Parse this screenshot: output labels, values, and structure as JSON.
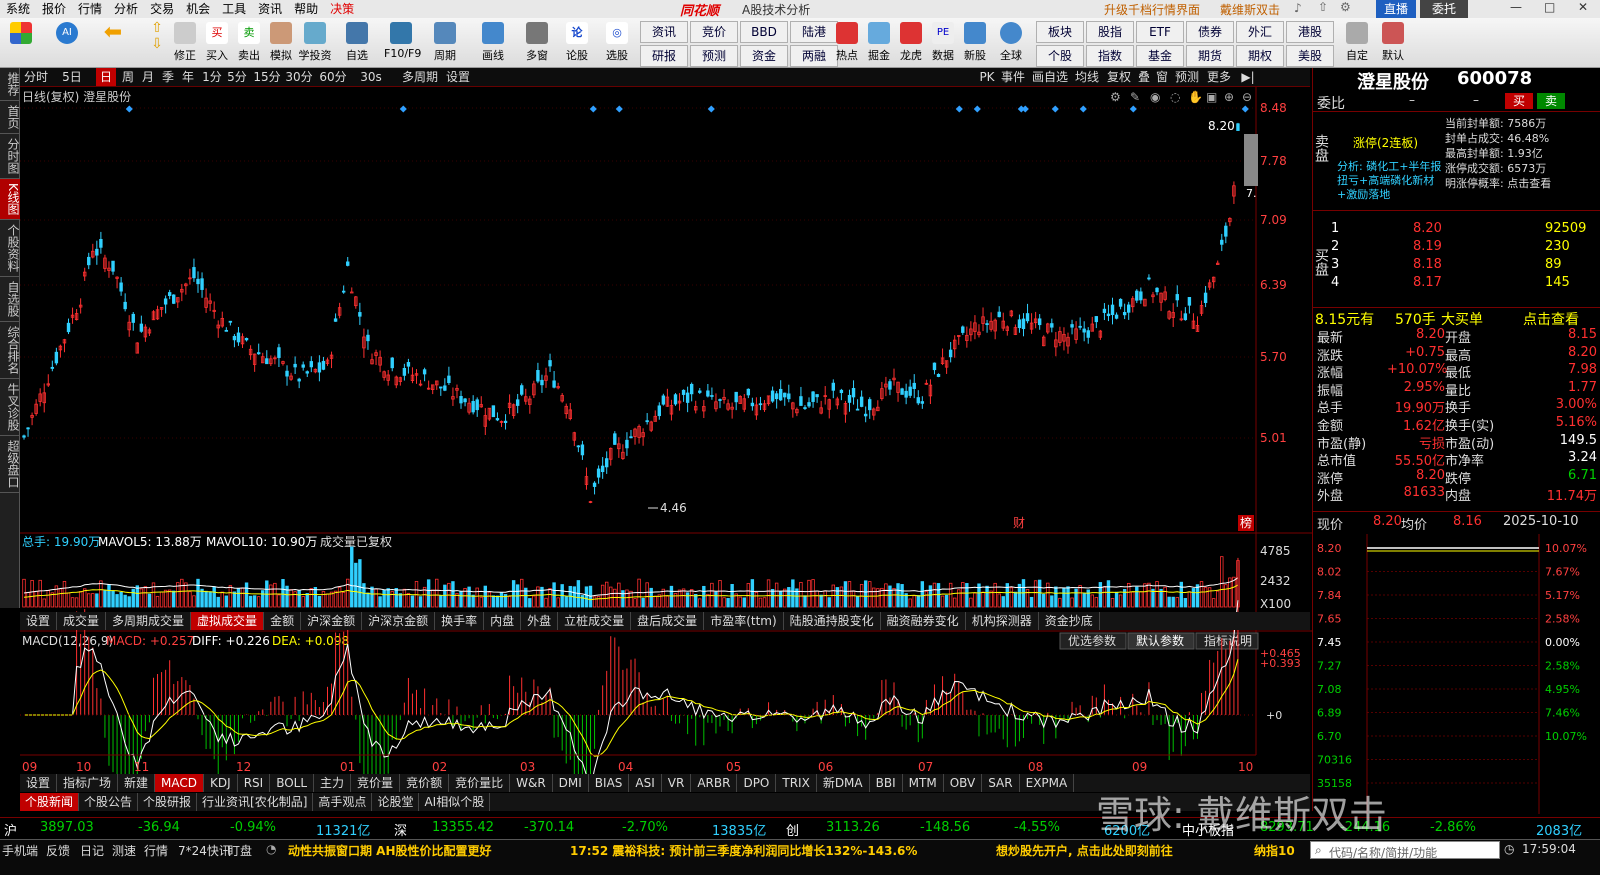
{
  "menu": [
    "系统",
    "报价",
    "行情",
    "分析",
    "交易",
    "机会",
    "工具",
    "资讯",
    "帮助",
    "决策"
  ],
  "menu_center": {
    "logo": "同花顺",
    "subtitle": "A股技术分析"
  },
  "menu_right": {
    "upgrade": "升级千档行情界面",
    "user": "戴维斯双击",
    "zhibo": "直播",
    "weituo": "委托"
  },
  "toolbar": [
    "修正",
    "买入",
    "卖出",
    "模拟",
    "学投资",
    "自选",
    "F10/F9",
    "周期",
    "画线",
    "多窗",
    "论股",
    "选股"
  ],
  "toolbar_grid": [
    "资讯",
    "竞价",
    "BBD",
    "陆港",
    "研报",
    "预测",
    "资金",
    "两融"
  ],
  "toolbar_right": [
    "热点",
    "掘金",
    "龙虎",
    "数据",
    "新股",
    "全球"
  ],
  "toolbar_grid2": [
    "板块",
    "股指",
    "ETF",
    "债券",
    "港股",
    "个股",
    "指数",
    "基金",
    "期货",
    "期权",
    "美股"
  ],
  "toolbar_far": [
    "外汇",
    "自定",
    "默认"
  ],
  "leftnav": [
    "推荐",
    "首页",
    "分时图",
    "K线图",
    "个股资料",
    "自选股",
    "综合排名",
    "牛叉诊股",
    "超级盘口"
  ],
  "periods": [
    "分时",
    "5日",
    "日",
    "周",
    "月",
    "季",
    "年",
    "1分",
    "5分",
    "15分",
    "30分",
    "60分",
    "30s",
    "多周期",
    "设置"
  ],
  "period_active": "日",
  "period_right": [
    "PK",
    "事件",
    "画自选",
    "均线",
    "复权",
    "叠",
    "窗",
    "预测",
    "更多"
  ],
  "chart_title": "日线(复权)  澄星股份",
  "y_ticks": [
    "8.48",
    "7.78",
    "7.09",
    "6.39",
    "5.70",
    "5.01"
  ],
  "price_labels": {
    "high": "8.20",
    "low": "4.46",
    "cur": "7."
  },
  "markers": [
    "财",
    "榜"
  ],
  "vol_header": {
    "zongshou": "总手: 19.90万",
    "mavol5": "MAVOL5: 13.88万",
    "mavol10": "MAVOL10: 10.90万",
    "note": "成交量已复权"
  },
  "vol_ticks": [
    "4785",
    "2432",
    "X100"
  ],
  "ind_tabs": [
    "设置",
    "成交量",
    "多周期成交量",
    "虚拟成交量",
    "金额",
    "沪深金额",
    "沪深京金额",
    "换手率",
    "内盘",
    "外盘",
    "立桩成交量",
    "盘后成交量",
    "市盈率(ttm)",
    "陆股通持股变化",
    "融资融券变化",
    "机构探测器",
    "资金抄底"
  ],
  "ind_tabs_active": "虚拟成交量",
  "macd_header": {
    "name": "MACD(12,26,9)",
    "macd": "MACD: +0.257",
    "diff": "DIFF: +0.226",
    "dea": "DEA: +0.098"
  },
  "macd_buttons": [
    "优选参数",
    "默认参数",
    "指标说明"
  ],
  "macd_ticks": [
    "+0.465",
    "+0.393",
    "+0"
  ],
  "months": [
    "09",
    "10",
    "11",
    "12",
    "01",
    "02",
    "03",
    "04",
    "05",
    "06",
    "07",
    "08",
    "09",
    "10"
  ],
  "ind_tabs2": [
    "设置",
    "指标广场",
    "新建",
    "MACD",
    "KDJ",
    "RSI",
    "BOLL",
    "主力",
    "竞价量",
    "竞价额",
    "竞价量比",
    "W&R",
    "DMI",
    "BIAS",
    "ASI",
    "VR",
    "ARBR",
    "DPO",
    "TRIX",
    "新DMA",
    "BBI",
    "MTM",
    "OBV",
    "SAR",
    "EXPMA"
  ],
  "ind_tabs2_active": "MACD",
  "news_tabs": [
    "个股新闻",
    "个股公告",
    "个股研报",
    "行业资讯[农化制品]",
    "高手观点",
    "论股堂",
    "AI相似个股"
  ],
  "news_tabs_active": "个股新闻",
  "rp": {
    "name": "澄星股份",
    "code": "600078",
    "weibi_label": "委比",
    "weibi": "–",
    "weicha": "–",
    "buy": "买",
    "sell": "卖",
    "zhangting": "涨停(2连板)",
    "fenxi": "分析: 磷化工+半年报扭亏+高端磷化新材+激励落地",
    "seal": [
      "当前封单额: 7586万",
      "封单占成交: 46.48%",
      "最高封单额: 1.93亿",
      "涨停成交额: 6573万",
      "明涨停概率: 点击查看"
    ],
    "sell_label": "卖盘",
    "buy_label": "买盘",
    "bids": [
      [
        "1",
        "8.20",
        "92509"
      ],
      [
        "2",
        "8.19",
        "230"
      ],
      [
        "3",
        "8.18",
        "89"
      ],
      [
        "4",
        "8.17",
        "145"
      ]
    ],
    "bigorder": [
      "8.15元有",
      "570手",
      "大买单",
      "点击查看"
    ],
    "stats": [
      [
        "最新",
        "8.20",
        "开盘",
        "8.15"
      ],
      [
        "涨跌",
        "+0.75",
        "最高",
        "8.20"
      ],
      [
        "涨幅",
        "+10.07%",
        "最低",
        "7.98"
      ],
      [
        "振幅",
        "2.95%",
        "量比",
        "1.77"
      ],
      [
        "总手",
        "19.90万",
        "换手",
        "3.00%"
      ],
      [
        "金额",
        "1.62亿",
        "换手(实)",
        "5.16%"
      ],
      [
        "市盈(静)",
        "亏损",
        "市盈(动)",
        "149.5"
      ],
      [
        "总市值",
        "55.50亿",
        "市净率",
        "3.24"
      ],
      [
        "涨停",
        "8.20",
        "跌停",
        "6.71"
      ],
      [
        "外盘",
        "81633",
        "内盘",
        "11.74万"
      ]
    ],
    "intraday": {
      "xianjia_label": "现价",
      "xianjia": "8.20",
      "junjia_label": "均价",
      "junjia": "8.16",
      "date": "2025-10-10"
    },
    "intra_left": [
      "8.20",
      "8.02",
      "7.84",
      "7.65",
      "7.45",
      "7.27",
      "7.08",
      "6.89",
      "6.70",
      "70316",
      "35158"
    ],
    "intra_right": [
      "10.07%",
      "7.67%",
      "5.17%",
      "2.58%",
      "0.00%",
      "2.58%",
      "4.95%",
      "7.46%",
      "10.07%"
    ]
  },
  "ticker": {
    "hu": "沪",
    "hu_v": "3897.03",
    "hu_c": "-36.94",
    "hu_p": "-0.94%",
    "hu_a": "11321亿",
    "shen": "深",
    "shen_v": "13355.42",
    "shen_c": "-370.14",
    "shen_p": "-2.70%",
    "shen_a": "13835亿",
    "chuang": "创",
    "ch_v": "3113.26",
    "ch_c": "-148.56",
    "ch_p": "-4.55%",
    "ch_a": "6200亿",
    "zx": "中小板指",
    "zx_v": "8293.71",
    "zx_c": "-244.16",
    "zx_p": "-2.86%",
    "zx_a": "2083亿"
  },
  "status": [
    "手机端",
    "反馈",
    "日记",
    "测速",
    "行情",
    "7*24快讯",
    "盯盘"
  ],
  "status_news": [
    "动性共振窗口期 AH股性价比配置更好",
    "17:52 震裕科技: 预计前三季度净利润同比增长132%-143.6%",
    "想炒股先开户, 点击此处即刻前往",
    "纳指10"
  ],
  "status_search": "代码/名称/简拼/功能",
  "time": "17:59:04",
  "watermark": "雪球: 戴维斯双击",
  "chart_data": {
    "type": "candlestick",
    "title": "日线(复权) 澄星股份",
    "x_months": [
      "09",
      "10",
      "11",
      "12",
      "01",
      "02",
      "03",
      "04",
      "05",
      "06",
      "07",
      "08",
      "09",
      "10"
    ],
    "ylim": [
      4.3,
      8.55
    ],
    "y_ticks": [
      8.48,
      7.78,
      7.09,
      6.39,
      5.7,
      5.01
    ],
    "close_anchors": [
      [
        0,
        5.2
      ],
      [
        8,
        6.0
      ],
      [
        14,
        6.6
      ],
      [
        17,
        7.1
      ],
      [
        22,
        6.9
      ],
      [
        28,
        6.2
      ],
      [
        34,
        6.5
      ],
      [
        42,
        6.8
      ],
      [
        48,
        6.4
      ],
      [
        55,
        6.1
      ],
      [
        60,
        6.0
      ],
      [
        68,
        5.8
      ],
      [
        75,
        5.9
      ],
      [
        80,
        6.9
      ],
      [
        85,
        6.1
      ],
      [
        90,
        5.9
      ],
      [
        98,
        5.8
      ],
      [
        108,
        5.6
      ],
      [
        118,
        5.4
      ],
      [
        125,
        5.6
      ],
      [
        130,
        5.85
      ],
      [
        135,
        5.5
      ],
      [
        140,
        4.6
      ],
      [
        145,
        5.0
      ],
      [
        150,
        5.2
      ],
      [
        158,
        5.5
      ],
      [
        165,
        5.6
      ],
      [
        175,
        5.5
      ],
      [
        185,
        5.6
      ],
      [
        193,
        5.5
      ],
      [
        200,
        5.6
      ],
      [
        208,
        5.5
      ],
      [
        215,
        5.7
      ],
      [
        222,
        5.6
      ],
      [
        228,
        6.0
      ],
      [
        235,
        6.3
      ],
      [
        242,
        6.4
      ],
      [
        250,
        6.3
      ],
      [
        258,
        6.2
      ],
      [
        265,
        6.3
      ],
      [
        272,
        6.5
      ],
      [
        278,
        6.7
      ],
      [
        284,
        6.5
      ],
      [
        290,
        6.4
      ],
      [
        295,
        6.9
      ],
      [
        298,
        7.4
      ],
      [
        300,
        8.2
      ]
    ],
    "high_label": 8.2,
    "low_label": 4.46,
    "volume": {
      "ticks": [
        4785,
        2432
      ],
      "unit": "X100",
      "mavol5": "13.88万",
      "mavol10": "10.90万"
    },
    "macd": {
      "macd": 0.257,
      "diff": 0.226,
      "dea": 0.098,
      "ticks": [
        0.465,
        0.393,
        0
      ]
    }
  }
}
